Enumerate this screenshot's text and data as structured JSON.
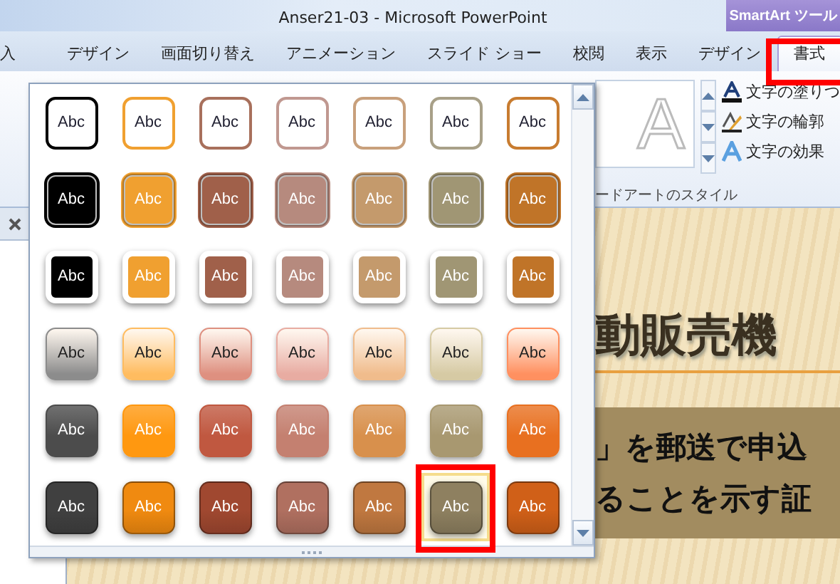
{
  "window": {
    "title": "Anser21-03  -  Microsoft PowerPoint"
  },
  "context_group": {
    "title": "SmartArt ツール"
  },
  "tabs": [
    {
      "label": "入",
      "selected": false
    },
    {
      "label": "デザイン",
      "selected": false
    },
    {
      "label": "画面切り替え",
      "selected": false
    },
    {
      "label": "アニメーション",
      "selected": false
    },
    {
      "label": "スライド ショー",
      "selected": false
    },
    {
      "label": "校閲",
      "selected": false
    },
    {
      "label": "表示",
      "selected": false
    },
    {
      "label": "デザイン",
      "selected": false
    },
    {
      "label": "書式",
      "selected": true
    }
  ],
  "ribbon": {
    "wordart_sample": "A",
    "commands": [
      "文字の塗りつ",
      "文字の輪郭",
      "文字の効果"
    ],
    "group_label": "ードアートのスタイル"
  },
  "gallery": {
    "rows": [
      {
        "kind": "outline",
        "styles": [
          {
            "label": "Abc",
            "color": "#000000",
            "selected": false
          },
          {
            "label": "Abc",
            "color": "#f0a030",
            "selected": false
          },
          {
            "label": "Abc",
            "color": "#a8705c",
            "selected": false
          },
          {
            "label": "Abc",
            "color": "#c09890",
            "selected": false
          },
          {
            "label": "Abc",
            "color": "#c8a07c",
            "selected": false
          },
          {
            "label": "Abc",
            "color": "#a8a088",
            "selected": false
          },
          {
            "label": "Abc",
            "color": "#c87c30",
            "selected": false
          }
        ]
      },
      {
        "kind": "filled",
        "styles": [
          {
            "label": "Abc",
            "color": "#000000",
            "selected": false
          },
          {
            "label": "Abc",
            "color": "#f0a030",
            "selected": false
          },
          {
            "label": "Abc",
            "color": "#a0604a",
            "selected": false
          },
          {
            "label": "Abc",
            "color": "#b68a7e",
            "selected": false
          },
          {
            "label": "Abc",
            "color": "#c49a6c",
            "selected": false
          },
          {
            "label": "Abc",
            "color": "#a09674",
            "selected": false
          },
          {
            "label": "Abc",
            "color": "#c07428",
            "selected": false
          }
        ]
      },
      {
        "kind": "framed",
        "styles": [
          {
            "label": "Abc",
            "color": "#000000",
            "selected": false
          },
          {
            "label": "Abc",
            "color": "#f0a030",
            "selected": false
          },
          {
            "label": "Abc",
            "color": "#a0604a",
            "selected": false
          },
          {
            "label": "Abc",
            "color": "#b68a7e",
            "selected": false
          },
          {
            "label": "Abc",
            "color": "#c49a6c",
            "selected": false
          },
          {
            "label": "Abc",
            "color": "#a09674",
            "selected": false
          },
          {
            "label": "Abc",
            "color": "#c07428",
            "selected": false
          }
        ]
      },
      {
        "kind": "light",
        "styles": [
          {
            "label": "Abc",
            "color": "#8c8c8c",
            "selected": false
          },
          {
            "label": "Abc",
            "color": "#ffbc60",
            "selected": false
          },
          {
            "label": "Abc",
            "color": "#de9080",
            "selected": false
          },
          {
            "label": "Abc",
            "color": "#e8aca2",
            "selected": false
          },
          {
            "label": "Abc",
            "color": "#f0bc8c",
            "selected": false
          },
          {
            "label": "Abc",
            "color": "#d6caa4",
            "selected": false
          },
          {
            "label": "Abc",
            "color": "#ff9060",
            "selected": false
          }
        ]
      },
      {
        "kind": "bright",
        "styles": [
          {
            "label": "Abc",
            "color": "#4c4c4c",
            "selected": false
          },
          {
            "label": "Abc",
            "color": "#ff9810",
            "selected": false
          },
          {
            "label": "Abc",
            "color": "#c05840",
            "selected": false
          },
          {
            "label": "Abc",
            "color": "#c48070",
            "selected": false
          },
          {
            "label": "Abc",
            "color": "#d8904c",
            "selected": false
          },
          {
            "label": "Abc",
            "color": "#a89870",
            "selected": false
          },
          {
            "label": "Abc",
            "color": "#e87020",
            "selected": false
          }
        ]
      },
      {
        "kind": "glossy",
        "styles": [
          {
            "label": "Abc",
            "color": "#404040",
            "selected": false
          },
          {
            "label": "Abc",
            "color": "#f08a10",
            "selected": false
          },
          {
            "label": "Abc",
            "color": "#a04830",
            "selected": false
          },
          {
            "label": "Abc",
            "color": "#b07060",
            "selected": false
          },
          {
            "label": "Abc",
            "color": "#c07840",
            "selected": false
          },
          {
            "label": "Abc",
            "color": "#8e8060",
            "selected": true
          },
          {
            "label": "Abc",
            "color": "#d06018",
            "selected": false
          }
        ]
      }
    ]
  },
  "slide": {
    "title": "動販売機",
    "lines": [
      "」を郵送で申込",
      "ることを示す証"
    ]
  }
}
